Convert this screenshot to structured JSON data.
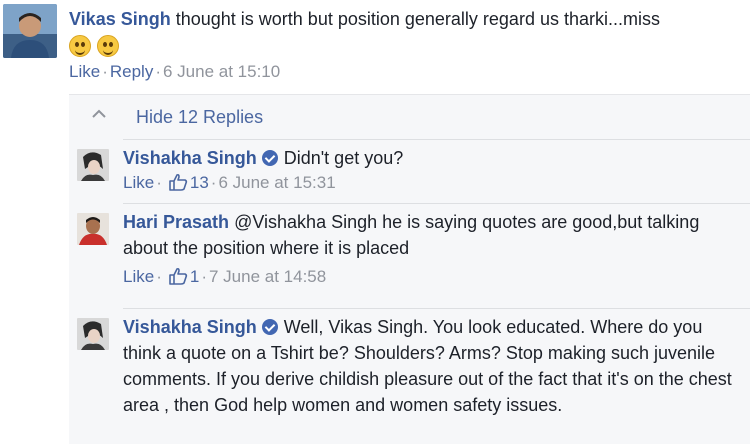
{
  "top_comment": {
    "author": "Vikas Singh",
    "text": "thought is worth but position generally regard us tharki...miss",
    "actions": {
      "like": "Like",
      "reply": "Reply",
      "timestamp": "6 June at 15:10"
    }
  },
  "replies_toggle": {
    "label": "Hide 12 Replies"
  },
  "replies": [
    {
      "author": "Vishakha Singh",
      "verified": true,
      "text": "Didn't get you?",
      "like": "Like",
      "like_count": "13",
      "timestamp": "6 June at 15:31"
    },
    {
      "author": "Hari Prasath",
      "verified": false,
      "text": "@Vishakha Singh he is saying quotes are good,but talking about the position where it is placed",
      "like": "Like",
      "like_count": "1",
      "timestamp": "7 June at 14:58"
    },
    {
      "author": "Vishakha Singh",
      "verified": true,
      "text": "Well, Vikas Singh. You look educated. Where do you think a quote on a Tshirt be? Shoulders? Arms? Stop making such juvenile comments. If you derive childish pleasure out of the fact that it's on the chest area , then God help women and women safety issues."
    }
  ],
  "colors": {
    "name": "#365899",
    "link": "#4b67a1",
    "muted": "#90949c",
    "verified_badge": "#4267b2"
  }
}
